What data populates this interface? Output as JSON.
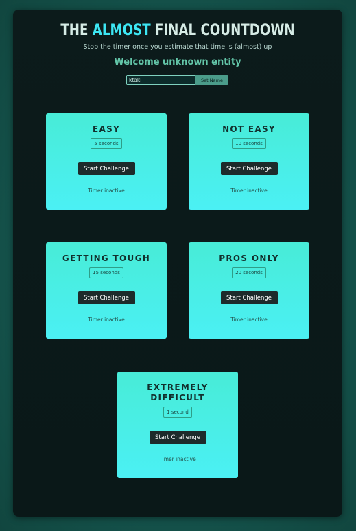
{
  "header": {
    "title_pre": "THE ",
    "title_highlight": "ALMOST",
    "title_post": " FINAL COUNTDOWN",
    "subtitle": "Stop the timer once you estimate that time is (almost) up",
    "welcome": "Welcome unknown entity"
  },
  "name_form": {
    "input_value": "ktaki",
    "button_label": "Set Name"
  },
  "challenges": [
    {
      "title": "EASY",
      "duration": "5 seconds",
      "button": "Start Challenge",
      "status": "Timer inactive"
    },
    {
      "title": "NOT EASY",
      "duration": "10 seconds",
      "button": "Start Challenge",
      "status": "Timer inactive"
    },
    {
      "title": "GETTING TOUGH",
      "duration": "15 seconds",
      "button": "Start Challenge",
      "status": "Timer inactive"
    },
    {
      "title": "PROS ONLY",
      "duration": "20 seconds",
      "button": "Start Challenge",
      "status": "Timer inactive"
    },
    {
      "title": "EXTREMELY DIFFICULT",
      "duration": "1 second",
      "button": "Start Challenge",
      "status": "Timer inactive"
    }
  ],
  "colors": {
    "accent": "#3de7f4",
    "card_top": "#48ecd7",
    "card_bottom": "#4bf0f4",
    "button": "#1d2b2b"
  }
}
